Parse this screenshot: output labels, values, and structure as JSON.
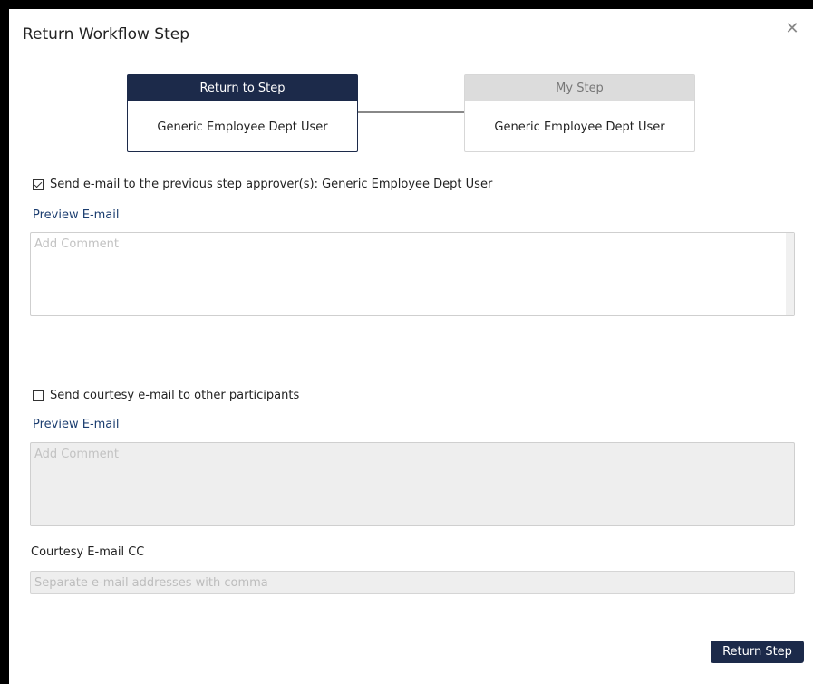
{
  "dialog": {
    "title": "Return Workflow Step",
    "close_icon": "close-icon"
  },
  "steps": {
    "return_to": {
      "header": "Return to Step",
      "name": "Generic Employee Dept User"
    },
    "my_step": {
      "header": "My Step",
      "name": "Generic Employee Dept User"
    }
  },
  "approver_email": {
    "checked": true,
    "label": "Send e-mail to the previous step approver(s): Generic Employee Dept User",
    "preview_link": "Preview E-mail",
    "comment_placeholder": "Add Comment"
  },
  "courtesy_email": {
    "checked": false,
    "label": "Send courtesy e-mail to other participants",
    "preview_link": "Preview E-mail",
    "comment_placeholder": "Add Comment"
  },
  "cc": {
    "label": "Courtesy E-mail CC",
    "placeholder": "Separate e-mail addresses with comma"
  },
  "actions": {
    "return_label": "Return Step"
  },
  "colors": {
    "primary": "#1c2a4a",
    "link": "#1c3e70",
    "inactive_header": "#dcdcdc",
    "disabled_field": "#eeeeee"
  }
}
